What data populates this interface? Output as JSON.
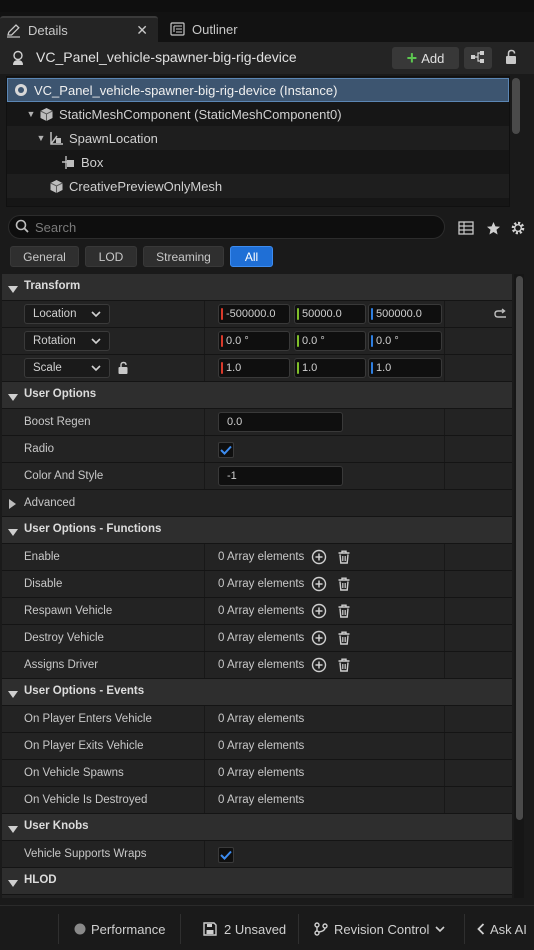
{
  "tabs": {
    "details": "Details",
    "outliner": "Outliner"
  },
  "header": {
    "title": "VC_Panel_vehicle-spawner-big-rig-device",
    "add_label": "Add"
  },
  "tree": {
    "items": [
      {
        "label": "VC_Panel_vehicle-spawner-big-rig-device (Instance)",
        "icon": "actor-icon"
      },
      {
        "label": "StaticMeshComponent (StaticMeshComponent0)",
        "icon": "static-mesh-icon"
      },
      {
        "label": "SpawnLocation",
        "icon": "scene-component-icon"
      },
      {
        "label": "Box",
        "icon": "box-collision-icon"
      },
      {
        "label": "CreativePreviewOnlyMesh",
        "icon": "static-mesh-icon"
      }
    ]
  },
  "search": {
    "placeholder": "Search"
  },
  "filters": [
    "General",
    "LOD",
    "Streaming",
    "All"
  ],
  "filter_active": "All",
  "sections": {
    "transform": "Transform",
    "user_options": "User Options",
    "advanced": "Advanced",
    "user_options_functions": "User Options - Functions",
    "user_options_events": "User Options - Events",
    "user_knobs": "User Knobs",
    "hlod": "HLOD"
  },
  "transform": {
    "location": {
      "label": "Location",
      "x": "-500000.0",
      "y": "50000.0",
      "z": "500000.0"
    },
    "rotation": {
      "label": "Rotation",
      "x": "0.0 °",
      "y": "0.0 °",
      "z": "0.0 °"
    },
    "scale": {
      "label": "Scale",
      "x": "1.0",
      "y": "1.0",
      "z": "1.0"
    }
  },
  "user_options": {
    "boost_regen": {
      "label": "Boost Regen",
      "value": "0.0"
    },
    "radio": {
      "label": "Radio",
      "checked": true
    },
    "color_and_style": {
      "label": "Color And Style",
      "value": "-1"
    }
  },
  "functions": [
    {
      "label": "Enable",
      "value": "0 Array elements"
    },
    {
      "label": "Disable",
      "value": "0 Array elements"
    },
    {
      "label": "Respawn Vehicle",
      "value": "0 Array elements"
    },
    {
      "label": "Destroy Vehicle",
      "value": "0 Array elements"
    },
    {
      "label": "Assigns Driver",
      "value": "0 Array elements"
    }
  ],
  "events": [
    {
      "label": "On Player Enters Vehicle",
      "value": "0 Array elements"
    },
    {
      "label": "On Player Exits Vehicle",
      "value": "0 Array elements"
    },
    {
      "label": "On Vehicle Spawns",
      "value": "0 Array elements"
    },
    {
      "label": "On Vehicle Is Destroyed",
      "value": "0 Array elements"
    }
  ],
  "user_knobs": {
    "vehicle_supports_wraps": {
      "label": "Vehicle Supports Wraps",
      "checked": true
    }
  },
  "status_bar": {
    "performance": "Performance",
    "unsaved": "2 Unsaved",
    "revision_control": "Revision Control",
    "ask_ai": "Ask AI"
  },
  "colors": {
    "accent": "#1f6fd6",
    "axis_x": "#d93a2b",
    "axis_y": "#7fbf2a",
    "axis_z": "#2f7fe0",
    "add_plus": "#5cc650",
    "tree_selected": "#3d5570"
  }
}
